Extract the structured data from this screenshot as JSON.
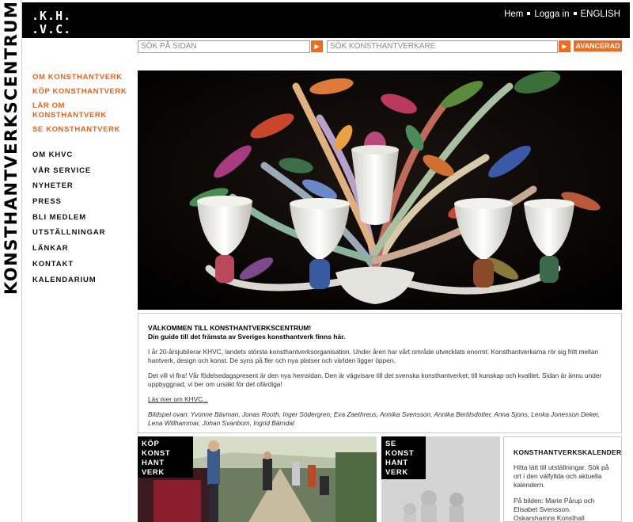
{
  "brand": {
    "vertical_title": "KONSTHANTVERKSCENTRUM",
    "logo_line1": ".K.H.",
    "logo_line2": ".V.C."
  },
  "topnav": {
    "home": "Hem",
    "login": "Logga in",
    "english": "ENGLISH"
  },
  "search": {
    "site_placeholder": "SÖK PÅ SIDAN",
    "artisan_placeholder": "SÖK KONSTHANTVERKARE",
    "advanced_label": "AVANCERAD",
    "go_symbol": "▶"
  },
  "leftnav": {
    "orange_items": [
      {
        "label": "OM KONSTHANTVERK"
      },
      {
        "label": "KÖP KONSTHANTVERK"
      },
      {
        "label": "LÄR OM KONSTHANTVERK"
      },
      {
        "label": "SE KONSTHANTVERK"
      }
    ],
    "black_items": [
      {
        "label": "OM KHVC"
      },
      {
        "label": "VÅR SERVICE"
      },
      {
        "label": "NYHETER"
      },
      {
        "label": "PRESS"
      },
      {
        "label": "BLI MEDLEM"
      },
      {
        "label": "UTSTÄLLNINGAR"
      },
      {
        "label": "LÄNKAR"
      },
      {
        "label": "KONTAKT"
      },
      {
        "label": "KALENDARIUM"
      }
    ]
  },
  "welcome": {
    "heading": "VÄLKOMMEN TILL KONSTHANTVERKSCENTRUM!",
    "subheading": "Din guide till det främsta av Sveriges konsthantverk finns här.",
    "p1": "I år 20-årsjubilerar KHVC, landets största konsthantverksorganisation. Under åren har vårt område utvecklats enormt. Konsthantverkarna rör sig fritt mellan hantverk, design och konst. De syns på fler och nya platser och världen ligger öppen.",
    "p2": "Det vill vi fira! Vår födelsedagspresent är den nya hemsidan. Den är vägvisare till det svenska konsthantverket; till kunskap och kvalitet. Sidan är ännu under uppbyggnad, vi ber om ursäkt för det ofärdiga!",
    "more_link": "Läs mer om KHVC...",
    "credits": "Bildspel ovan: Yvonne Bävman, Jonas Rooth, Inger Södergren, Eva Zaethreus, Annika Svensson, Annika Bertilsdotter, Anna Sjons, Lenka Jonesson Deker, Lena Willhammar, Johan Svanbom, Ingrid Bärndal"
  },
  "cards": {
    "buy": "KÖP KONST HANT VERK",
    "see": "SE KONST HANT VERK"
  },
  "calendar": {
    "title": "KONSTHANTVERKSKALENDER",
    "p1": "Hitta lätt till utställningar. Sök på ort i den välfyllda och aktuella kalendern.",
    "p2": "På bilden: Marie Pårup och Elisabet Svensson. Oskarshamns Konsthall"
  },
  "colors": {
    "accent": "#f26a1b",
    "header_bg": "#000000"
  }
}
